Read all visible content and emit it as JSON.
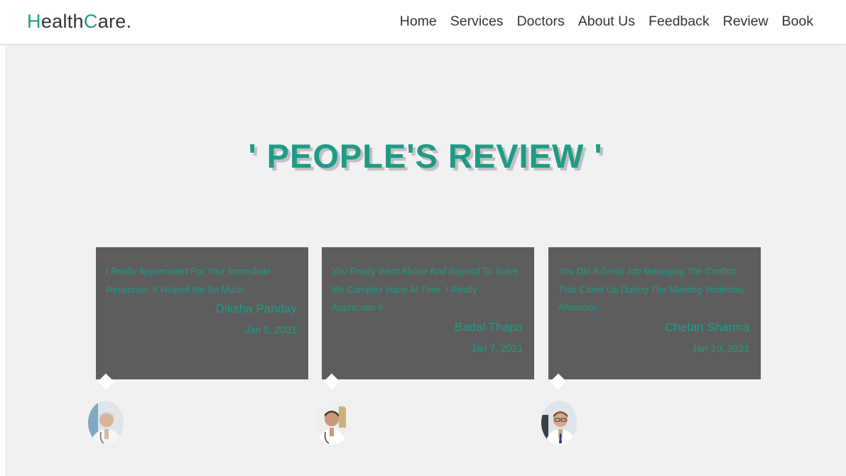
{
  "logo": {
    "part1": "H",
    "part2": "ealth",
    "part3": "C",
    "part4": "are."
  },
  "nav": [
    "Home",
    "Services",
    "Doctors",
    "About Us",
    "Feedback",
    "Review",
    "Book"
  ],
  "section": {
    "heading": "' PEOPLE'S REVIEW '"
  },
  "reviews": [
    {
      "text": "I Really Appreciated For Your Immediate Response. It Helped Me So Much.",
      "name": "Diksha Panday",
      "date": "Jan 5, 2021",
      "avatar": "doctor-avatar-icon"
    },
    {
      "text": "You Really Went Above And Beyond To Solve My Complex Issue At Time. I Really Appreciate It.",
      "name": "Badal Thapa",
      "date": "Jan 7, 2021",
      "avatar": "doctor-avatar-icon"
    },
    {
      "text": "You Did A Great Job Managing The Conflict That Came Up During The Meeting Yesterday Afternoon.",
      "name": "Chetan Sharma",
      "date": "Jan 10, 2021",
      "avatar": "doctor-avatar-icon"
    }
  ],
  "colors": {
    "accent": "#1a9f86",
    "card_bg": "#5d5d5d",
    "section_bg": "#f1f1f1",
    "nav_text": "#333333"
  }
}
